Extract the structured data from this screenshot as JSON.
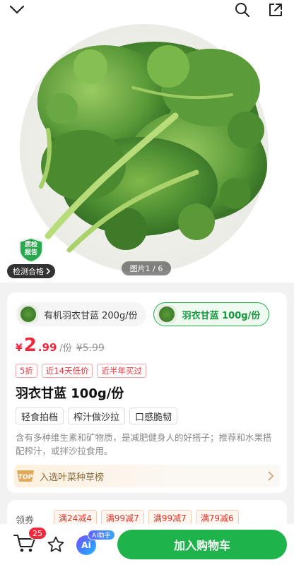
{
  "topbar": {
    "back_icon": "chevron-down-icon",
    "search_icon": "search-icon",
    "share_icon": "share-icon"
  },
  "hero": {
    "badge_text": "质检报告",
    "badge_line1": "质检",
    "badge_line2": "报告",
    "inspection_pill": "检测合格",
    "page_indicator": "图片1 / 6"
  },
  "variants": [
    {
      "label": "有机羽衣甘蓝 200g/份",
      "selected": false
    },
    {
      "label": "羽衣甘蓝 100g/份",
      "selected": true
    }
  ],
  "price": {
    "currency": "¥",
    "integer": "2",
    "decimal": ".99",
    "unit": "/份",
    "original": "¥5.99"
  },
  "promo_tags": [
    "5折",
    "近14天低价",
    "近半年买过"
  ],
  "product_title": "羽衣甘蓝 100g/份",
  "features": [
    "轻食拍档",
    "榨汁做沙拉",
    "口感脆韧"
  ],
  "description": "含有多种维生素和矿物质，是减肥健身人的好搭子；推荐和水果搭配榨汁，或拌沙拉食用。",
  "ranking": {
    "badge": "TOP",
    "text": "入选叶菜种草榜"
  },
  "coupons": {
    "label": "领券",
    "items": [
      "满24减4",
      "满99减7",
      "满99减7",
      "满79减6"
    ]
  },
  "bottom_bar": {
    "cart_count": "25",
    "ai_label": "Ai",
    "ai_badge": "AI助手",
    "add_to_cart": "加入购物车"
  },
  "colors": {
    "accent_green": "#1fb34b",
    "price_red": "#f0263b",
    "tag_red": "#e8343a"
  }
}
